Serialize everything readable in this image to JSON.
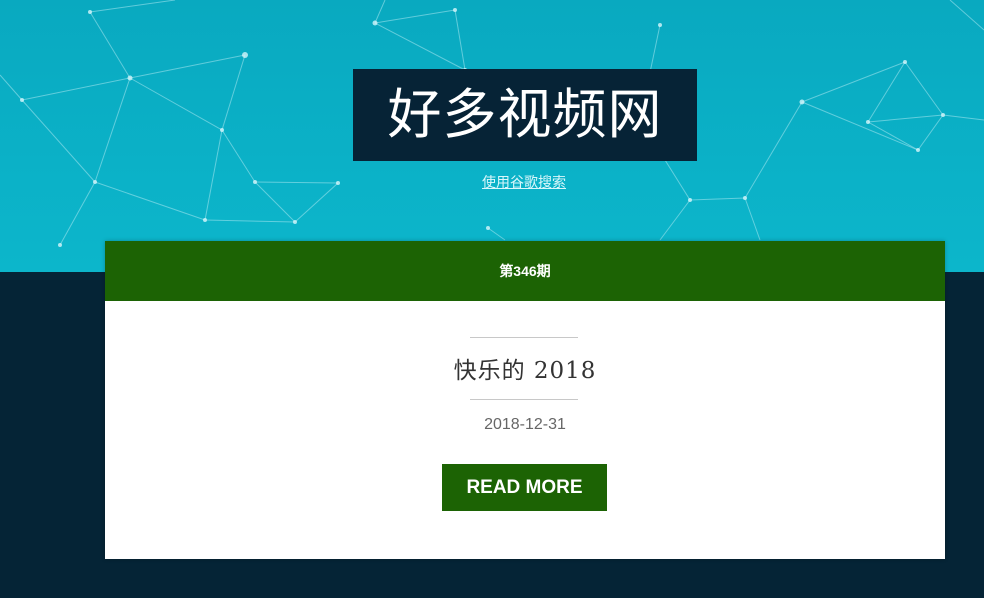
{
  "site": {
    "title": "好多视频网",
    "search_link": "使用谷歌搜索"
  },
  "post": {
    "issue_label": "第346期",
    "title": "快乐的 2018",
    "date": "2018-12-31",
    "read_more_label": "READ MORE"
  },
  "colors": {
    "hero_background": "#0bb1c7",
    "page_background": "#052436",
    "accent_green": "#1c6304",
    "card_background": "#ffffff"
  }
}
